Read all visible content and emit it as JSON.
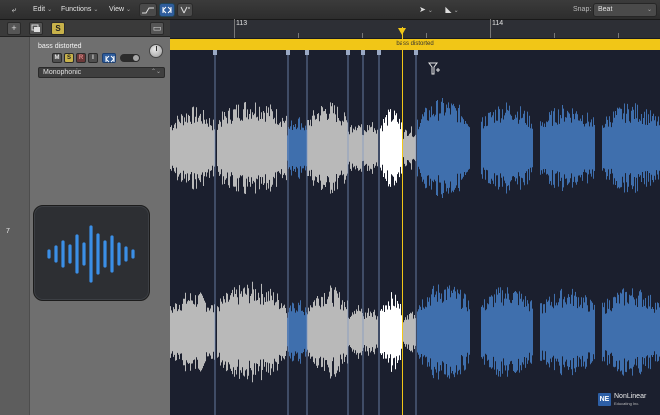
{
  "menubar": {
    "edit": "Edit",
    "functions": "Functions",
    "view": "View",
    "snap_label": "Snap:",
    "snap_value": "Beat"
  },
  "toolbar": {
    "add": "+",
    "solo": "S"
  },
  "track": {
    "name": "bass distorted",
    "mute": "M",
    "solo": "S",
    "record": "R",
    "input": "I",
    "mode": "Monophonic",
    "number": "7"
  },
  "ruler": {
    "bar_113": "113",
    "bar_114": "114"
  },
  "region": {
    "name": "bass distorted"
  },
  "logo": {
    "mark": "NE",
    "name": "NonLinear",
    "sub": "Educating Inc."
  },
  "colors": {
    "region_yellow": "#f1c617",
    "wave_gray": "#b9b9b9",
    "wave_blue": "#3f6fad",
    "wave_white": "#ffffff",
    "background": "#1b1f2e"
  },
  "icons": [
    "back-arrow-icon",
    "pointer-tool-icon",
    "flex-tool-icon",
    "scissors-icon",
    "waveform-icon",
    "flex-marker-cursor-icon"
  ]
}
